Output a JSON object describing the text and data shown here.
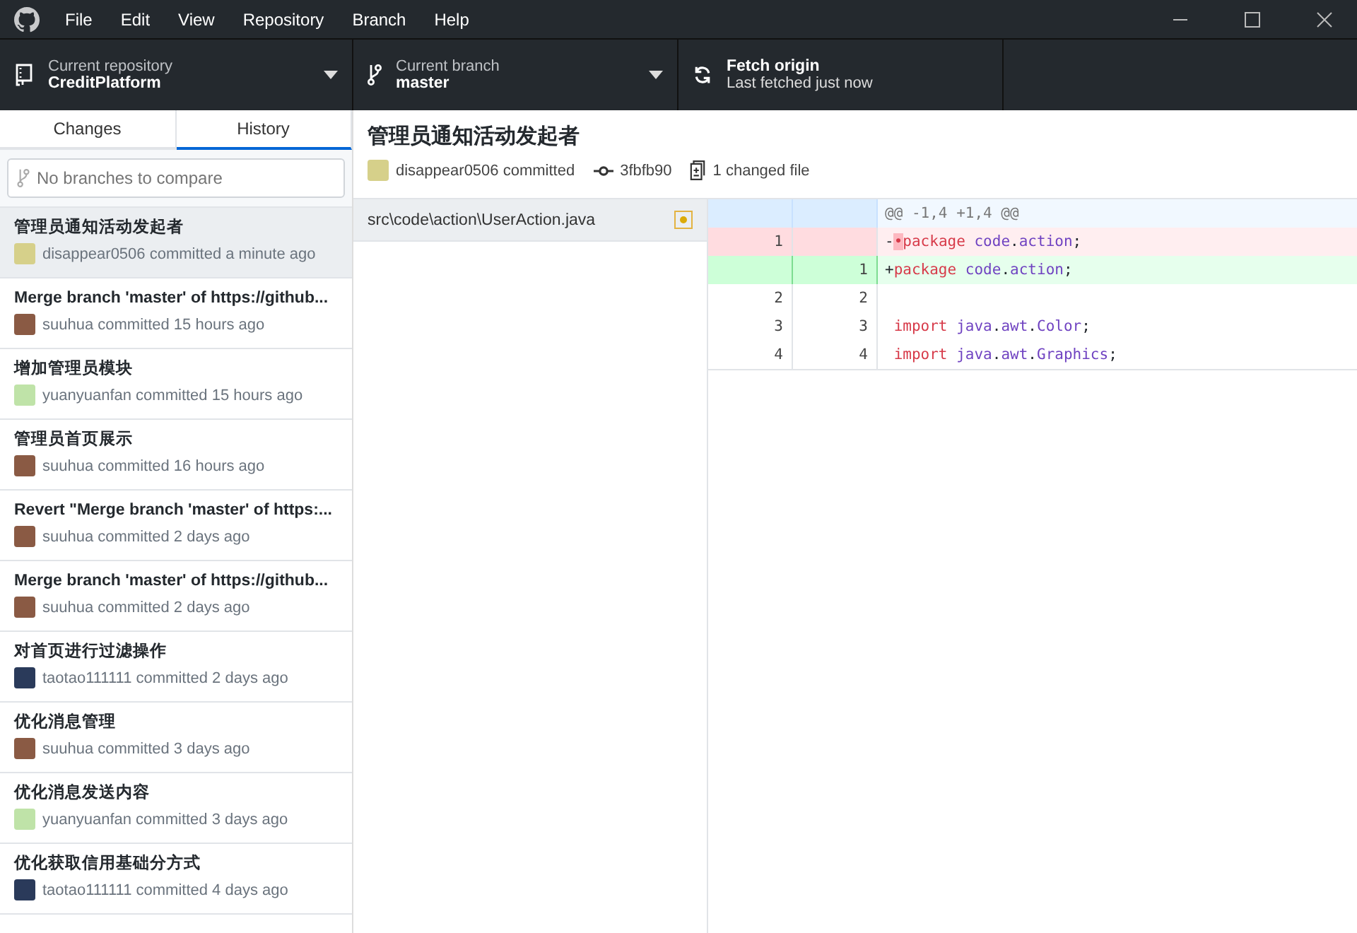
{
  "menu": [
    "File",
    "Edit",
    "View",
    "Repository",
    "Branch",
    "Help"
  ],
  "toolbar": {
    "repository": {
      "label": "Current repository",
      "value": "CreditPlatform"
    },
    "branch": {
      "label": "Current branch",
      "value": "master"
    },
    "fetch": {
      "label": "Fetch origin",
      "value": "Last fetched just now"
    }
  },
  "tabs": [
    {
      "label": "Changes",
      "selected": false
    },
    {
      "label": "History",
      "selected": true
    }
  ],
  "compare": {
    "placeholder": "No branches to compare"
  },
  "commits": [
    {
      "title": "管理员通知活动发起者",
      "meta": "disappear0506 committed a minute ago",
      "color": "#d6d08a",
      "selected": true
    },
    {
      "title": "Merge branch 'master' of https://github...",
      "meta": "suuhua committed 15 hours ago",
      "color": "#8a5a44",
      "selected": false
    },
    {
      "title": "增加管理员模块",
      "meta": "yuanyuanfan committed 15 hours ago",
      "color": "#bfe3a8",
      "selected": false
    },
    {
      "title": "管理员首页展示",
      "meta": "suuhua committed 16 hours ago",
      "color": "#8a5a44",
      "selected": false
    },
    {
      "title": "Revert \"Merge branch 'master' of https:...",
      "meta": "suuhua committed 2 days ago",
      "color": "#8a5a44",
      "selected": false
    },
    {
      "title": "Merge branch 'master' of https://github...",
      "meta": "suuhua committed 2 days ago",
      "color": "#8a5a44",
      "selected": false
    },
    {
      "title": "对首页进行过滤操作",
      "meta": "taotao111111 committed 2 days ago",
      "color": "#2a3a5a",
      "selected": false
    },
    {
      "title": "优化消息管理",
      "meta": "suuhua committed 3 days ago",
      "color": "#8a5a44",
      "selected": false
    },
    {
      "title": "优化消息发送内容",
      "meta": "yuanyuanfan committed 3 days ago",
      "color": "#bfe3a8",
      "selected": false
    },
    {
      "title": "优化获取信用基础分方式",
      "meta": "taotao111111 committed 4 days ago",
      "color": "#2a3a5a",
      "selected": false
    }
  ],
  "detail": {
    "title": "管理员通知活动发起者",
    "author": "disappear0506 committed",
    "color": "#d6d08a",
    "sha": "3fbfb90",
    "files_changed": "1 changed file"
  },
  "files": [
    {
      "path": "src\\code\\action\\UserAction.java",
      "kind": "modified",
      "selected": true
    }
  ],
  "diff": [
    {
      "kind": "hunk",
      "tokens": [
        {
          "t": "@@ -1,4 +1,4 @@",
          "kind": "plain"
        }
      ]
    },
    {
      "kind": "del",
      "old": "1",
      "tokens": [
        {
          "t": "-",
          "kind": "plain"
        },
        {
          "t": "•",
          "kind": "mark"
        },
        {
          "t": "package ",
          "kind": "kw"
        },
        {
          "t": "code",
          "kind": "id"
        },
        {
          "t": ".",
          "kind": "plain"
        },
        {
          "t": "action",
          "kind": "id"
        },
        {
          "t": ";",
          "kind": "plain"
        }
      ]
    },
    {
      "kind": "add",
      "new": "1",
      "tokens": [
        {
          "t": "+",
          "kind": "plain"
        },
        {
          "t": "package ",
          "kind": "kw"
        },
        {
          "t": "code",
          "kind": "id"
        },
        {
          "t": ".",
          "kind": "plain"
        },
        {
          "t": "action",
          "kind": "id"
        },
        {
          "t": ";",
          "kind": "plain"
        }
      ]
    },
    {
      "kind": "ctx",
      "old": "2",
      "new": "2"
    },
    {
      "kind": "ctx",
      "old": "3",
      "new": "3",
      "tokens": [
        {
          "t": " import ",
          "kind": "kw"
        },
        {
          "t": "java",
          "kind": "id"
        },
        {
          "t": ".",
          "kind": "plain"
        },
        {
          "t": "awt",
          "kind": "id"
        },
        {
          "t": ".",
          "kind": "plain"
        },
        {
          "t": "Color",
          "kind": "id"
        },
        {
          "t": ";",
          "kind": "plain"
        }
      ]
    },
    {
      "kind": "ctx",
      "old": "4",
      "new": "4",
      "tokens": [
        {
          "t": " import ",
          "kind": "kw"
        },
        {
          "t": "java",
          "kind": "id"
        },
        {
          "t": ".",
          "kind": "plain"
        },
        {
          "t": "awt",
          "kind": "id"
        },
        {
          "t": ".",
          "kind": "plain"
        },
        {
          "t": "Graphics",
          "kind": "id"
        },
        {
          "t": ";",
          "kind": "plain"
        }
      ]
    }
  ]
}
